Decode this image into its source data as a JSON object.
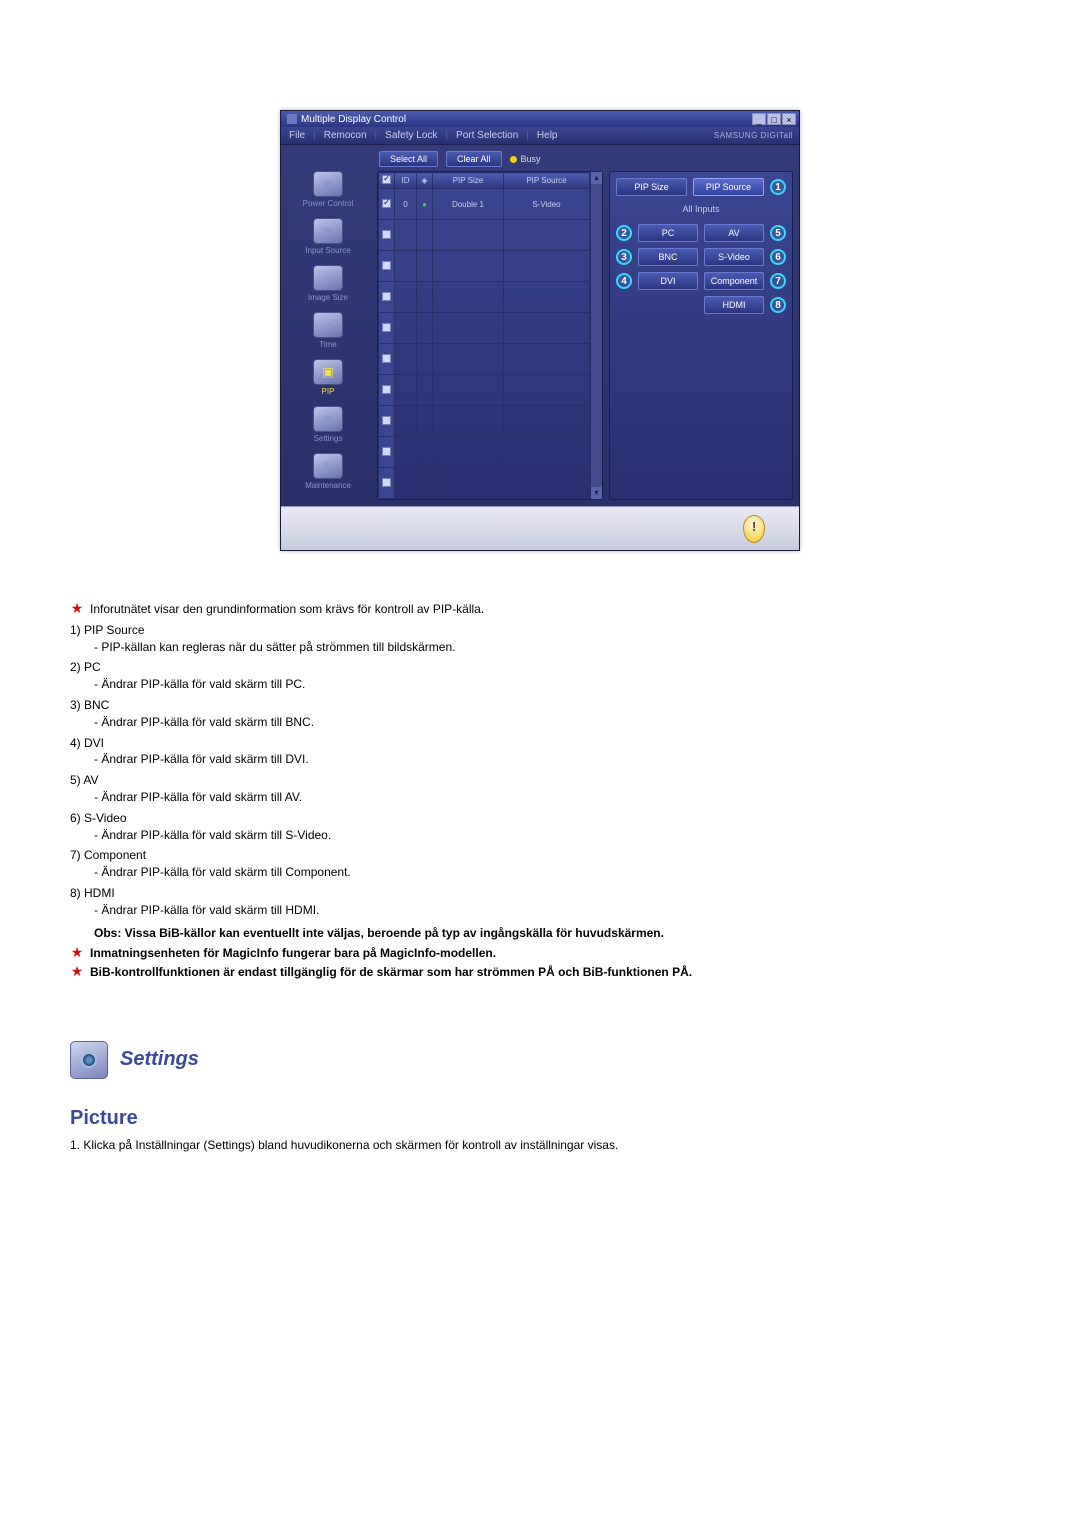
{
  "app": {
    "title": "Multiple Display Control",
    "menus": [
      "File",
      "Remocon",
      "Safety Lock",
      "Port Selection",
      "Help"
    ],
    "brand": "SAMSUNG DIGITall",
    "winbtns": {
      "min": "_",
      "restore": "□",
      "close": "×"
    }
  },
  "sidenav": {
    "items": [
      {
        "label": "Power Control",
        "glyph": "◉"
      },
      {
        "label": "Input Source",
        "glyph": "▣"
      },
      {
        "label": "Image Size",
        "glyph": "◎"
      },
      {
        "label": "Time",
        "glyph": "◔"
      },
      {
        "label": "PIP",
        "glyph": "▣",
        "active": true
      },
      {
        "label": "Settings",
        "glyph": "◉"
      },
      {
        "label": "Maintenance",
        "glyph": "✎"
      }
    ]
  },
  "toolbar": {
    "select_all": "Select All",
    "clear_all": "Clear All",
    "busy": "Busy"
  },
  "table": {
    "headers": {
      "chk": "",
      "id": "ID",
      "status": "",
      "pip_size": "PIP Size",
      "pip_source": "PIP Source"
    },
    "rows": [
      {
        "chk": true,
        "id": "0",
        "status": "●",
        "pip_size": "Double 1",
        "pip_source": "S-Video"
      },
      {
        "chk": false,
        "id": "",
        "status": "",
        "pip_size": "",
        "pip_source": ""
      },
      {
        "chk": false,
        "id": "",
        "status": "",
        "pip_size": "",
        "pip_source": ""
      },
      {
        "chk": false,
        "id": "",
        "status": "",
        "pip_size": "",
        "pip_source": ""
      },
      {
        "chk": false,
        "id": "",
        "status": "",
        "pip_size": "",
        "pip_source": ""
      },
      {
        "chk": false,
        "id": "",
        "status": "",
        "pip_size": "",
        "pip_source": ""
      },
      {
        "chk": false,
        "id": "",
        "status": "",
        "pip_size": "",
        "pip_source": ""
      },
      {
        "chk": false,
        "id": "",
        "status": "",
        "pip_size": "",
        "pip_source": ""
      },
      {
        "chk": false,
        "id": "",
        "status": "",
        "pip_size": "",
        "pip_source": ""
      },
      {
        "chk": false,
        "id": "",
        "status": "",
        "pip_size": "",
        "pip_source": ""
      }
    ]
  },
  "right": {
    "pip_size": "PIP Size",
    "pip_source": "PIP Source",
    "all_inputs": "All Inputs",
    "buttons": {
      "pc": "PC",
      "av": "AV",
      "bnc": "BNC",
      "svideo": "S-Video",
      "dvi": "DVI",
      "component": "Component",
      "hdmi": "HDMI"
    },
    "callouts": {
      "c1": "1",
      "c2": "2",
      "c3": "3",
      "c4": "4",
      "c5": "5",
      "c6": "6",
      "c7": "7",
      "c8": "8"
    }
  },
  "doc": {
    "intro": "Inforutnätet visar den grundinformation som krävs för kontroll av PIP-källa.",
    "items": [
      {
        "num": "1",
        "lead": "PIP Source",
        "body": "- PIP-källan kan regleras när du sätter på strömmen till bildskärmen."
      },
      {
        "num": "2",
        "lead": "PC",
        "body": "- Ändrar PIP-källa för vald skärm till PC."
      },
      {
        "num": "3",
        "lead": "BNC",
        "body": "- Ändrar PIP-källa för vald skärm till BNC."
      },
      {
        "num": "4",
        "lead": "DVI",
        "body": "- Ändrar PIP-källa för vald skärm till DVI."
      },
      {
        "num": "5",
        "lead": "AV",
        "body": "- Ändrar PIP-källa för vald skärm till AV."
      },
      {
        "num": "6",
        "lead": "S-Video",
        "body": "- Ändrar PIP-källa för vald skärm till S-Video."
      },
      {
        "num": "7",
        "lead": "Component",
        "body": "- Ändrar PIP-källa för vald skärm till Component."
      },
      {
        "num": "8",
        "lead": "HDMI",
        "body": "- Ändrar PIP-källa för vald skärm till HDMI."
      }
    ],
    "obs": "Obs: Vissa BiB-källor kan eventuellt inte väljas, beroende på typ av ingångskälla för huvudskärmen.",
    "star2": "Inmatningsenheten för MagicInfo fungerar bara på MagicInfo-modellen.",
    "star3": "BiB-kontrollfunktionen är endast tillgänglig för de skärmar som har strömmen PÅ och BiB-funktionen PÅ.",
    "settings_title": "Settings",
    "picture_title": "Picture",
    "picture_step1": "Klicka på Inställningar (Settings) bland huvudikonerna och skärmen för kontroll av inställningar visas."
  }
}
